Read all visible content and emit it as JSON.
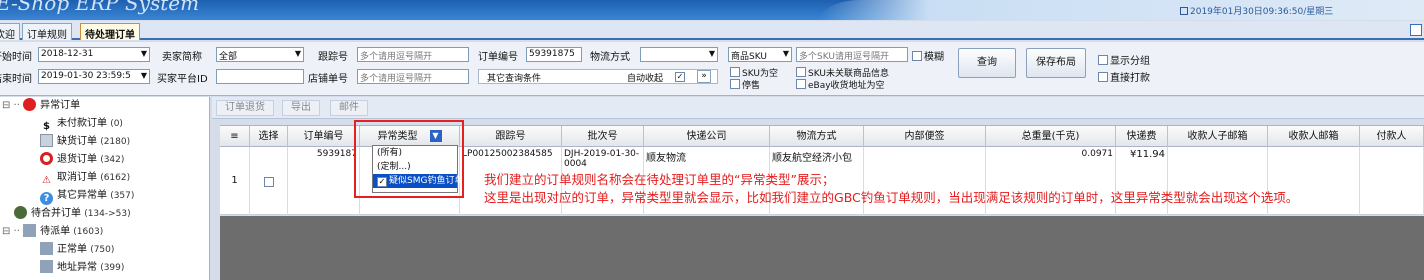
{
  "app": {
    "title": "E-Shop ERP System",
    "datetime": "2019年01月30日09:36:50/星期三"
  },
  "tabs": [
    {
      "label": "欢迎"
    },
    {
      "label": "订单规则"
    },
    {
      "label": "待处理订单"
    }
  ],
  "filters": {
    "start_time_label": "开始时间",
    "start_time": "2018-12-31",
    "end_time_label": "结束时间",
    "end_time": "2019-01-30 23:59:5",
    "seller_label": "卖家简称",
    "seller": "全部",
    "buyer_platform_label": "买家平台ID",
    "buyer_platform": "",
    "tracking_label": "跟踪号",
    "tracking_ph": "多个请用逗号隔开",
    "shop_order_label": "店铺单号",
    "shop_order_ph": "多个请用逗号隔开",
    "order_no_label": "订单编号",
    "order_no": "59391875",
    "shipping_label": "物流方式",
    "shipping": "",
    "other_cond": "其它查询条件",
    "auto_collapse": "自动收起",
    "sku_select": "商品SKU",
    "sku_ph": "多个SKU请用逗号隔开",
    "fuzzy": "模糊",
    "sku_empty": "SKU为空",
    "stop_sale": "停售",
    "sku_unlinked": "SKU未关联商品信息",
    "ebay_empty": "eBay收货地址为空",
    "query_btn": "查询",
    "save_layout_btn": "保存布局",
    "show_group": "显示分组",
    "direct_print": "直接打款"
  },
  "tree": [
    {
      "label": "异常订单",
      "count": "",
      "icon": "error-icon"
    },
    {
      "label": "未付款订单",
      "count": "(0)",
      "icon": "dollar-icon"
    },
    {
      "label": "缺货订单",
      "count": "(2180)",
      "icon": "box-icon"
    },
    {
      "label": "退货订单",
      "count": "(342)",
      "icon": "return-icon"
    },
    {
      "label": "取消订单",
      "count": "(6162)",
      "icon": "warning-icon"
    },
    {
      "label": "其它异常单",
      "count": "(357)",
      "icon": "question-icon"
    },
    {
      "label": "待合并订单",
      "count": "(134->53)",
      "icon": "merge-icon"
    },
    {
      "label": "待派单",
      "count": "(1603)",
      "icon": "dispatch-icon"
    },
    {
      "label": "正常单",
      "count": "(750)",
      "icon": "normal-icon"
    },
    {
      "label": "地址异常",
      "count": "(399)",
      "icon": "address-icon"
    }
  ],
  "toolbar": {
    "return_btn": "订单退货",
    "export_btn": "导出",
    "mail_btn": "邮件"
  },
  "columns": [
    "选择",
    "订单编号",
    "异常类型",
    "跟踪号",
    "批次号",
    "快递公司",
    "物流方式",
    "内部便签",
    "总重量(千克)",
    "快递费",
    "收款人子邮箱",
    "收款人邮箱",
    "付款人"
  ],
  "row": {
    "index": "1",
    "order_no": "5939187",
    "tracking": "LP00125002384585",
    "batch": "DJH-2019-01-30-0004",
    "courier": "顺友物流",
    "shipping": "顺友航空经济小包",
    "weight": "0.0971",
    "fee": "¥11.94"
  },
  "dropdown": {
    "items": [
      "(所有)",
      "(定制...)",
      "疑似SMG钓鱼订单"
    ]
  },
  "annotation": {
    "line1": "我们建立的订单规则名称会在待处理订单里的“异常类型”展示；",
    "line2": "这里是出现对应的订单，异常类型里就会显示，比如我们建立的GBC钓鱼订单规则，当出现满足该规则的订单时，这里异常类型就会出现这个选项。"
  }
}
